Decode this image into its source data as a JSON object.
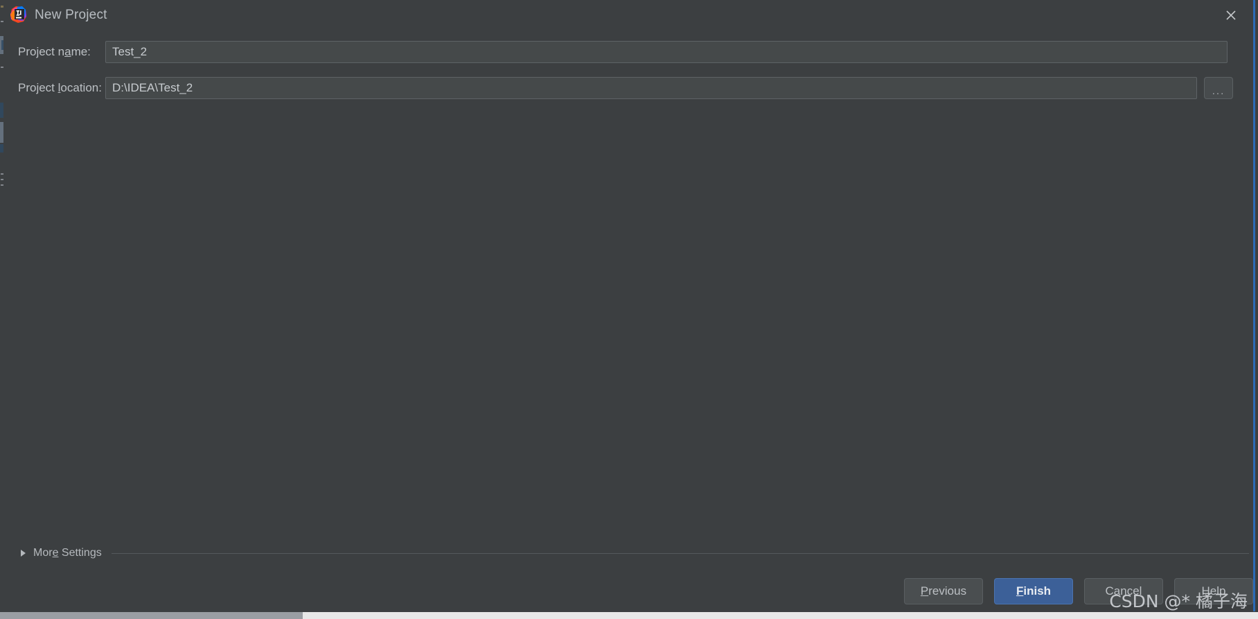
{
  "dialog": {
    "title": "New Project",
    "app_icon": "intellij-idea-icon",
    "close_icon": "close-icon",
    "focus_border_color": "#2d6ab5",
    "background_color": "#3c3f41"
  },
  "form": {
    "rows": [
      {
        "label_before": "Project n",
        "label_mnemonic": "a",
        "label_after": "me:",
        "value": "Test_2",
        "placeholder": ""
      },
      {
        "label_before": "Project ",
        "label_mnemonic": "l",
        "label_after": "ocation:",
        "value": "D:\\IDEA\\Test_2",
        "placeholder": ""
      }
    ],
    "browse_label": "...",
    "browse_icon": "ellipsis-icon"
  },
  "more_settings": {
    "label_before": "Mor",
    "label_mnemonic": "e",
    "label_after": " Settings",
    "expanded": false,
    "triangle_icon": "chevron-right-icon"
  },
  "buttons": [
    {
      "label_before": "",
      "label_mnemonic": "P",
      "label_after": "revious",
      "name": "previous-button",
      "primary": false
    },
    {
      "label_before": "",
      "label_mnemonic": "F",
      "label_after": "inish",
      "name": "finish-button",
      "primary": true
    },
    {
      "label_before": "Cancel",
      "label_mnemonic": "",
      "label_after": "",
      "name": "cancel-button",
      "primary": false
    },
    {
      "label_before": "Help",
      "label_mnemonic": "",
      "label_after": "",
      "name": "help-button",
      "primary": false
    }
  ],
  "watermark": {
    "text": "CSDN @* 橘子海"
  },
  "colors": {
    "accent": "#3c6098",
    "field_bg": "#45494a",
    "text": "#bcc0c4"
  }
}
